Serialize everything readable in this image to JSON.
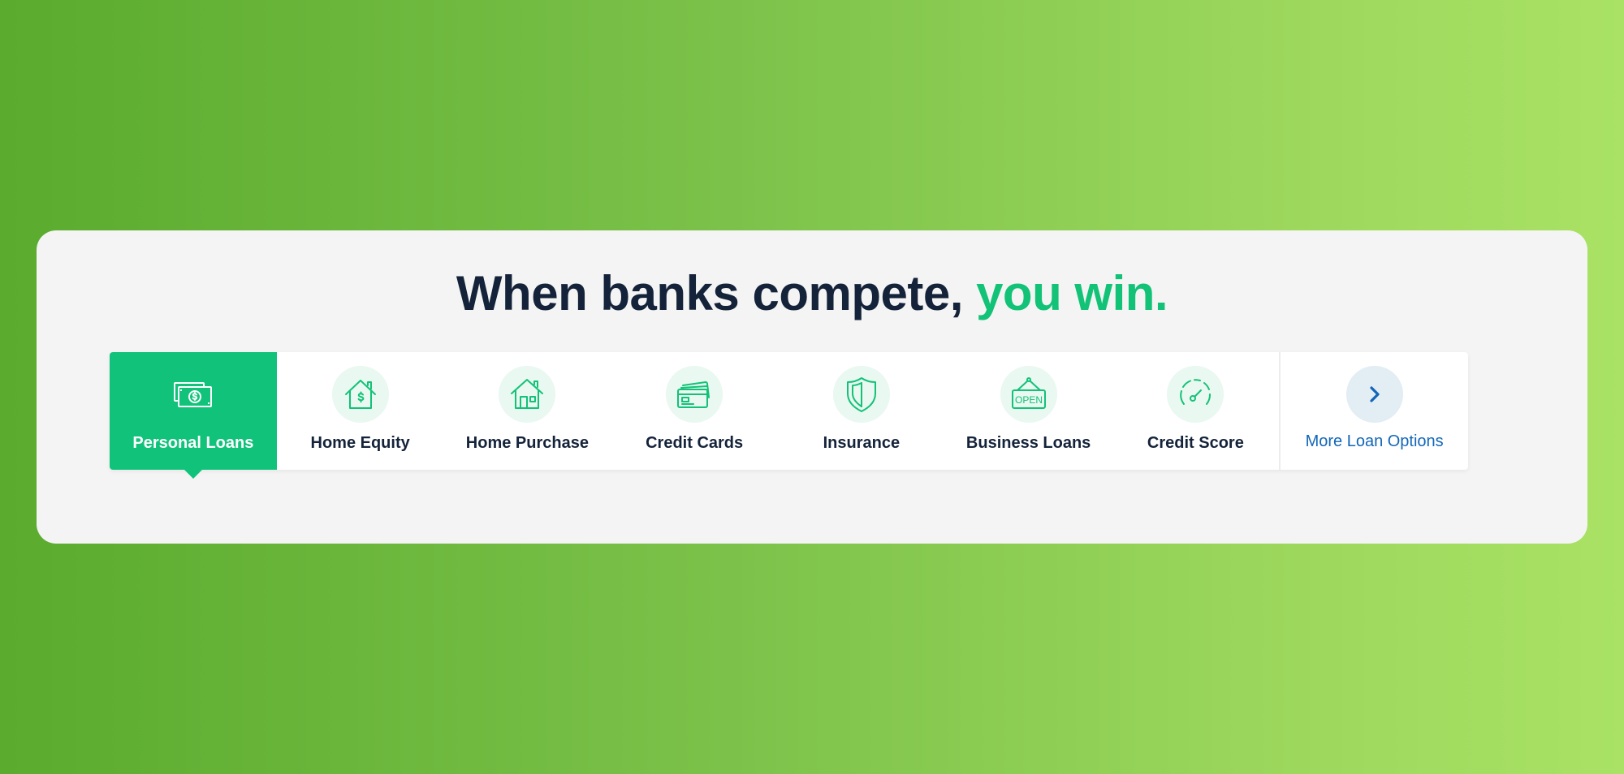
{
  "headline": {
    "main": "When banks compete, ",
    "accent": "you win."
  },
  "colors": {
    "accent_green": "#12c277",
    "active_tab": "#11c37a",
    "headline_text": "#14233a",
    "link_blue": "#1166b8"
  },
  "tabs": [
    {
      "label": "Personal Loans",
      "icon": "money-icon",
      "active": true
    },
    {
      "label": "Home Equity",
      "icon": "house-dollar-icon",
      "active": false
    },
    {
      "label": "Home Purchase",
      "icon": "house-icon",
      "active": false
    },
    {
      "label": "Credit Cards",
      "icon": "credit-cards-icon",
      "active": false
    },
    {
      "label": "Insurance",
      "icon": "shield-icon",
      "active": false
    },
    {
      "label": "Business Loans",
      "icon": "open-sign-icon",
      "active": false
    },
    {
      "label": "Credit Score",
      "icon": "gauge-icon",
      "active": false
    }
  ],
  "more": {
    "label": "More Loan Options",
    "icon": "chevron-right-icon"
  }
}
